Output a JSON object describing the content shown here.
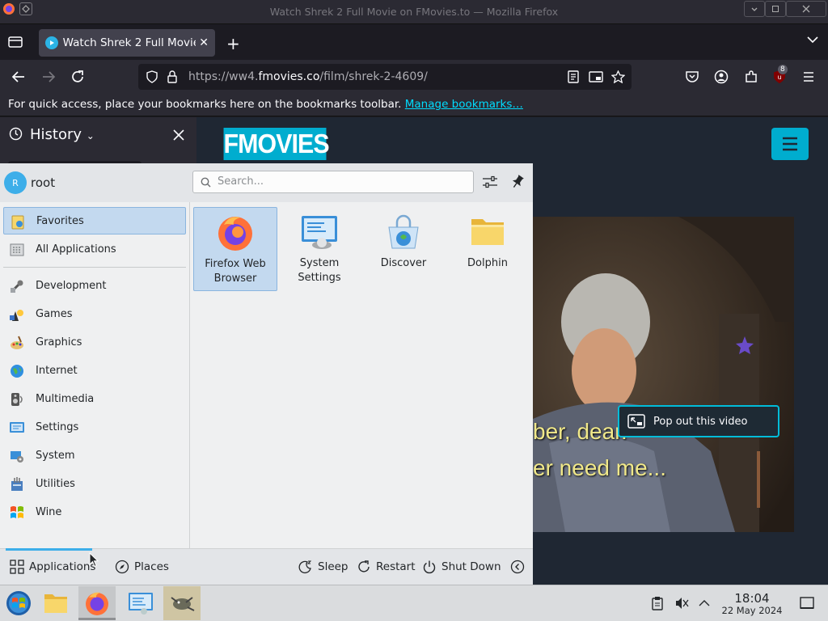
{
  "window": {
    "title": "Watch Shrek 2 Full Movie on FMovies.to — Mozilla Firefox"
  },
  "browser": {
    "tab_title": "Watch Shrek 2 Full Movie on FMovies.to",
    "url_prefix": "https://ww4.",
    "url_domain": "fmovies.co",
    "url_path": "/film/shrek-2-4609/",
    "extension_badge": "8",
    "bookmarks_message": "For quick access, place your bookmarks here on the bookmarks toolbar.",
    "bookmarks_link": "Manage bookmarks…",
    "sidebar_title": "History"
  },
  "page": {
    "logo_text": "FMOVIES",
    "subtitle_line1": "ber, dear.",
    "subtitle_line2": "er need me...",
    "popout_label": "Pop out this video"
  },
  "launcher": {
    "user": "root",
    "avatar_letter": "R",
    "search_placeholder": "Search...",
    "categories": [
      {
        "label": "Favorites",
        "icon": "favorites-icon"
      },
      {
        "label": "All Applications",
        "icon": "all-apps-icon"
      },
      {
        "label": "Development",
        "icon": "development-icon"
      },
      {
        "label": "Games",
        "icon": "games-icon"
      },
      {
        "label": "Graphics",
        "icon": "graphics-icon"
      },
      {
        "label": "Internet",
        "icon": "internet-icon"
      },
      {
        "label": "Multimedia",
        "icon": "multimedia-icon"
      },
      {
        "label": "Settings",
        "icon": "settings-icon"
      },
      {
        "label": "System",
        "icon": "system-icon"
      },
      {
        "label": "Utilities",
        "icon": "utilities-icon"
      },
      {
        "label": "Wine",
        "icon": "wine-icon"
      }
    ],
    "favorites": [
      {
        "label": "Firefox Web Browser",
        "icon": "firefox-icon"
      },
      {
        "label": "System Settings",
        "icon": "system-settings-icon"
      },
      {
        "label": "Discover",
        "icon": "discover-icon"
      },
      {
        "label": "Dolphin",
        "icon": "folder-icon"
      }
    ],
    "footer": {
      "applications": "Applications",
      "places": "Places",
      "sleep": "Sleep",
      "restart": "Restart",
      "shutdown": "Shut Down"
    }
  },
  "taskbar": {
    "time": "18:04",
    "date": "22 May 2024"
  },
  "colors": {
    "accent": "#00adcf",
    "selection": "#c3d9ef",
    "plasma_blue": "#3daee9"
  }
}
